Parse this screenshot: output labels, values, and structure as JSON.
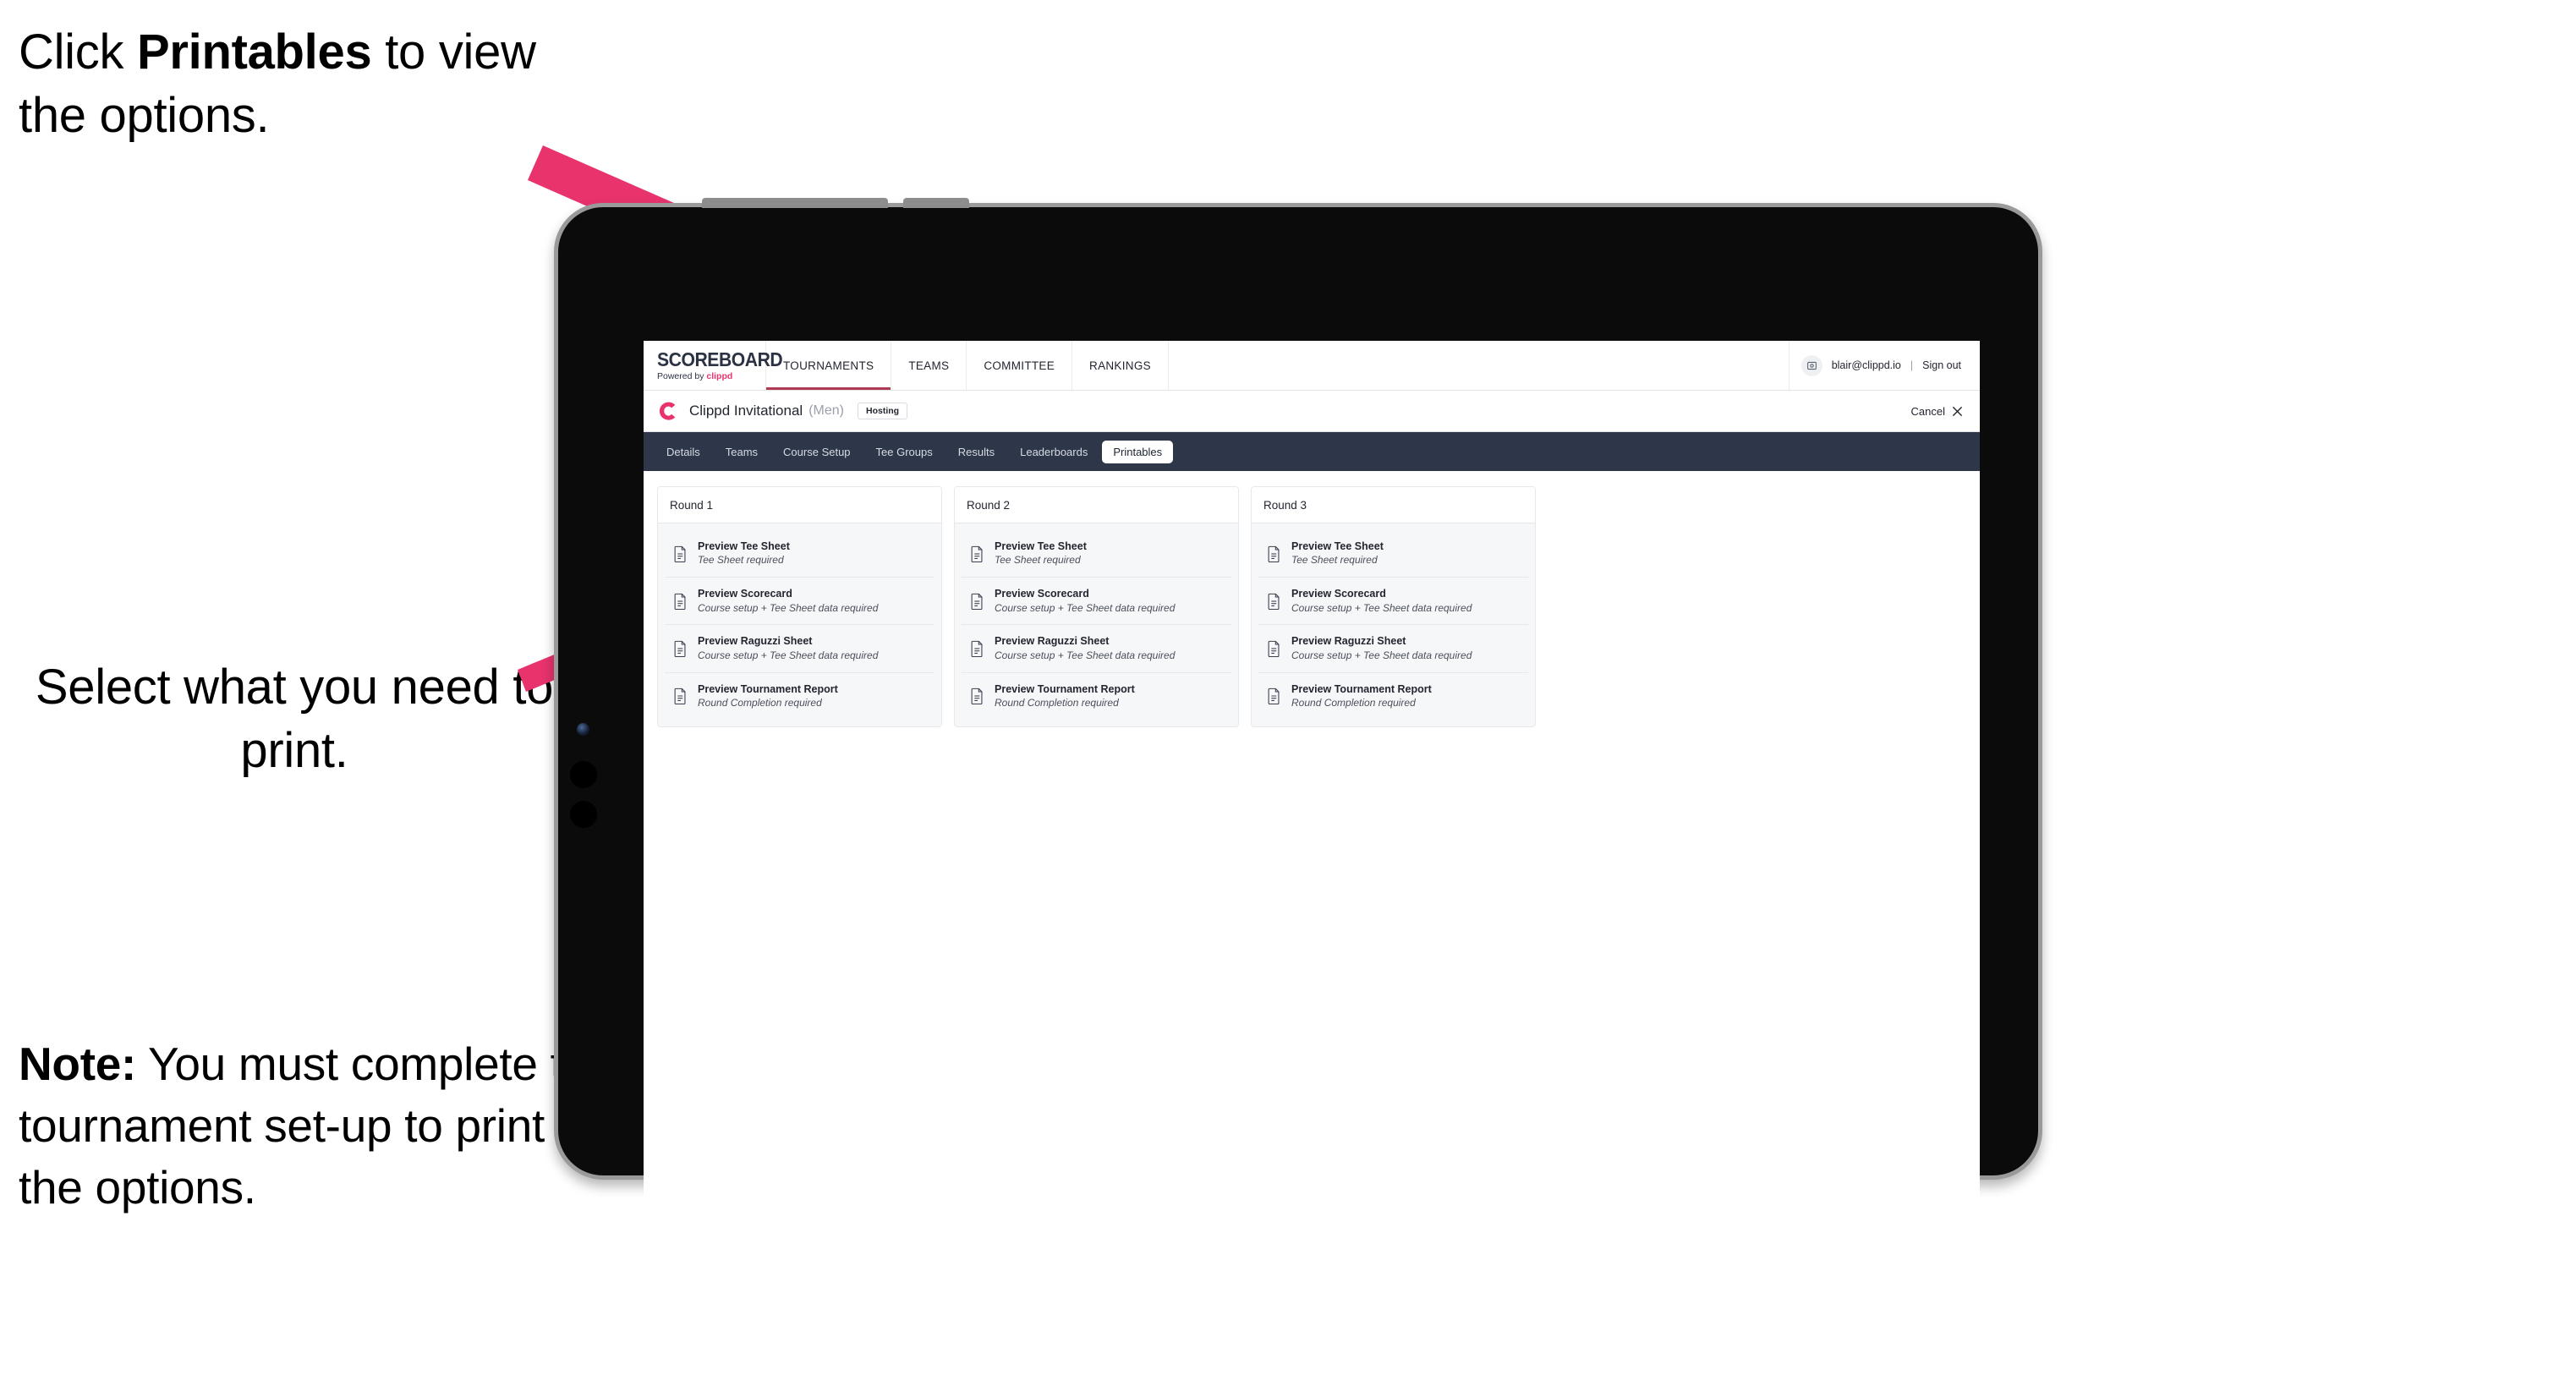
{
  "annotations": {
    "click_prefix": "Click ",
    "click_bold": "Printables",
    "click_suffix": " to view the options.",
    "select_text": "Select what you need to print.",
    "note_bold": "Note:",
    "note_text": " You must complete the tournament set-up to print all the options."
  },
  "colors": {
    "arrow": "#e8336d",
    "brand_pink": "#e8336d",
    "tabstrip_bg": "#2e3749",
    "nav_underline": "#b03a55",
    "page_bg": "#ffffff",
    "card_bg": "#f6f7f9",
    "device_body": "#0b0b0b",
    "device_edge": "#9a9a9a"
  },
  "browser": {
    "topnav": {
      "logo_word": "SCOREBOARD",
      "logo_sub_prefix": "Powered by ",
      "logo_sub_brand": "clippd",
      "items": [
        {
          "label": "TOURNAMENTS",
          "active": true
        },
        {
          "label": "TEAMS",
          "active": false
        },
        {
          "label": "COMMITTEE",
          "active": false
        },
        {
          "label": "RANKINGS",
          "active": false
        }
      ],
      "avatar_icon": "user-avatar-icon",
      "user_email": "blair@clippd.io",
      "separator": "|",
      "sign_out": "Sign out"
    },
    "titlebar": {
      "logo_icon": "clippd-c-logo-icon",
      "tournament_name": "Clippd Invitational",
      "gender": "(Men)",
      "hosting_badge": "Hosting",
      "cancel_label": "Cancel",
      "cancel_icon": "close-x-icon"
    },
    "tabs": [
      {
        "label": "Details",
        "active": false
      },
      {
        "label": "Teams",
        "active": false
      },
      {
        "label": "Course Setup",
        "active": false
      },
      {
        "label": "Tee Groups",
        "active": false
      },
      {
        "label": "Results",
        "active": false
      },
      {
        "label": "Leaderboards",
        "active": false
      },
      {
        "label": "Printables",
        "active": true
      }
    ],
    "rounds": [
      {
        "title": "Round 1",
        "items": [
          {
            "icon": "document-icon",
            "title": "Preview Tee Sheet",
            "sub": "Tee Sheet required"
          },
          {
            "icon": "document-icon",
            "title": "Preview Scorecard",
            "sub": "Course setup + Tee Sheet data required"
          },
          {
            "icon": "document-icon",
            "title": "Preview Raguzzi Sheet",
            "sub": "Course setup + Tee Sheet data required"
          },
          {
            "icon": "document-icon",
            "title": "Preview Tournament Report",
            "sub": "Round Completion required"
          }
        ]
      },
      {
        "title": "Round 2",
        "items": [
          {
            "icon": "document-icon",
            "title": "Preview Tee Sheet",
            "sub": "Tee Sheet required"
          },
          {
            "icon": "document-icon",
            "title": "Preview Scorecard",
            "sub": "Course setup + Tee Sheet data required"
          },
          {
            "icon": "document-icon",
            "title": "Preview Raguzzi Sheet",
            "sub": "Course setup + Tee Sheet data required"
          },
          {
            "icon": "document-icon",
            "title": "Preview Tournament Report",
            "sub": "Round Completion required"
          }
        ]
      },
      {
        "title": "Round 3",
        "items": [
          {
            "icon": "document-icon",
            "title": "Preview Tee Sheet",
            "sub": "Tee Sheet required"
          },
          {
            "icon": "document-icon",
            "title": "Preview Scorecard",
            "sub": "Course setup + Tee Sheet data required"
          },
          {
            "icon": "document-icon",
            "title": "Preview Raguzzi Sheet",
            "sub": "Course setup + Tee Sheet data required"
          },
          {
            "icon": "document-icon",
            "title": "Preview Tournament Report",
            "sub": "Round Completion required"
          }
        ]
      }
    ]
  }
}
